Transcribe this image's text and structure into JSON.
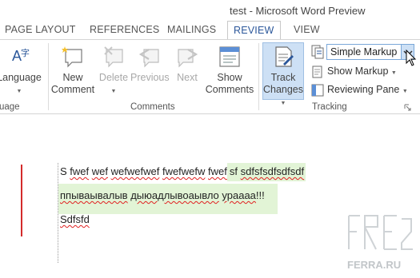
{
  "window": {
    "title": "test - Microsoft Word Preview"
  },
  "tabs": [
    {
      "label": "PAGE LAYOUT"
    },
    {
      "label": "REFERENCES"
    },
    {
      "label": "MAILINGS"
    },
    {
      "label": "REVIEW"
    },
    {
      "label": "VIEW"
    }
  ],
  "ribbon": {
    "language": {
      "label": "Language",
      "group_label": "uage"
    },
    "comments": {
      "new_comment": {
        "line1": "New",
        "line2": "Comment"
      },
      "delete": "Delete",
      "previous": "Previous",
      "next": "Next",
      "show_comments": {
        "line1": "Show",
        "line2": "Comments"
      },
      "group_label": "Comments"
    },
    "tracking": {
      "track_changes": {
        "line1": "Track",
        "line2": "Changes"
      },
      "display_for_review": "Simple Markup",
      "show_markup": "Show Markup",
      "reviewing_pane": "Reviewing Pane",
      "group_label": "Tracking"
    }
  },
  "document": {
    "line1": {
      "start": "S",
      "w1": "fwef",
      "w2": "wef",
      "w3": "wefwefwef",
      "w4": "fwefwefw",
      "w5": "fwef",
      "inserted_plain": "sf",
      "inserted_sq": "sdfsfsdfsdfsdf"
    },
    "line2": {
      "p1": "ппываывалыв",
      "p2": "дыюадлывоаывло",
      "p3": "ураааа",
      "p4": "!!!"
    },
    "line3": "Sdfsfd"
  },
  "watermark": {
    "text": "FERRA.RU"
  },
  "colors": {
    "accent": "#2b579a",
    "insert_highlight": "#e2f4d6",
    "change_bar": "#d42b2b",
    "pressed_button": "#cde0f5"
  }
}
